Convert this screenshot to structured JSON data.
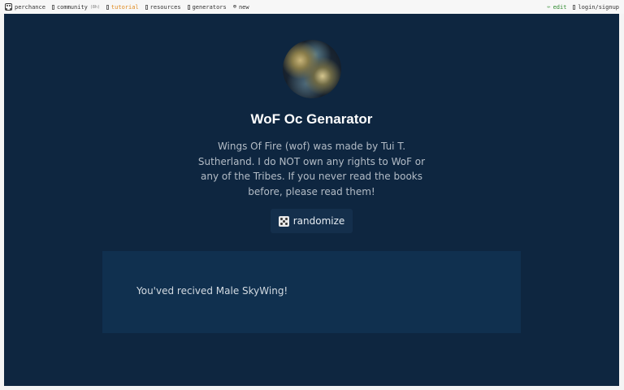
{
  "topbar": {
    "left": [
      {
        "icon": "dice-icon",
        "label": "perchance",
        "active": false
      },
      {
        "icon": "box-icon",
        "label": "community",
        "badge": "(8h)",
        "active": false
      },
      {
        "icon": "box-icon",
        "label": "tutorial",
        "active": true
      },
      {
        "icon": "box-icon",
        "label": "resources",
        "active": false
      },
      {
        "icon": "box-icon",
        "label": "generators",
        "active": false
      },
      {
        "icon": "plus-circle-icon",
        "label": "new",
        "active": false
      }
    ],
    "right": [
      {
        "icon": "pencil-icon",
        "label": "edit"
      },
      {
        "icon": "box-icon",
        "label": "login/signup"
      }
    ]
  },
  "page": {
    "title": "WoF Oc Genarator",
    "description": "Wings Of Fire (wof) was made by Tui T. Sutherland. I do NOT own any rights to WoF or any of the Tribes. If you never read the books before, please read them!",
    "randomize_label": "randomize",
    "output": "You'ved recived Male SkyWing!"
  },
  "colors": {
    "background": "#0e2640",
    "output_panel": "#10304f",
    "button": "#142f4c",
    "active_link": "#e08a1e",
    "edit_link": "#2f8a2f"
  }
}
